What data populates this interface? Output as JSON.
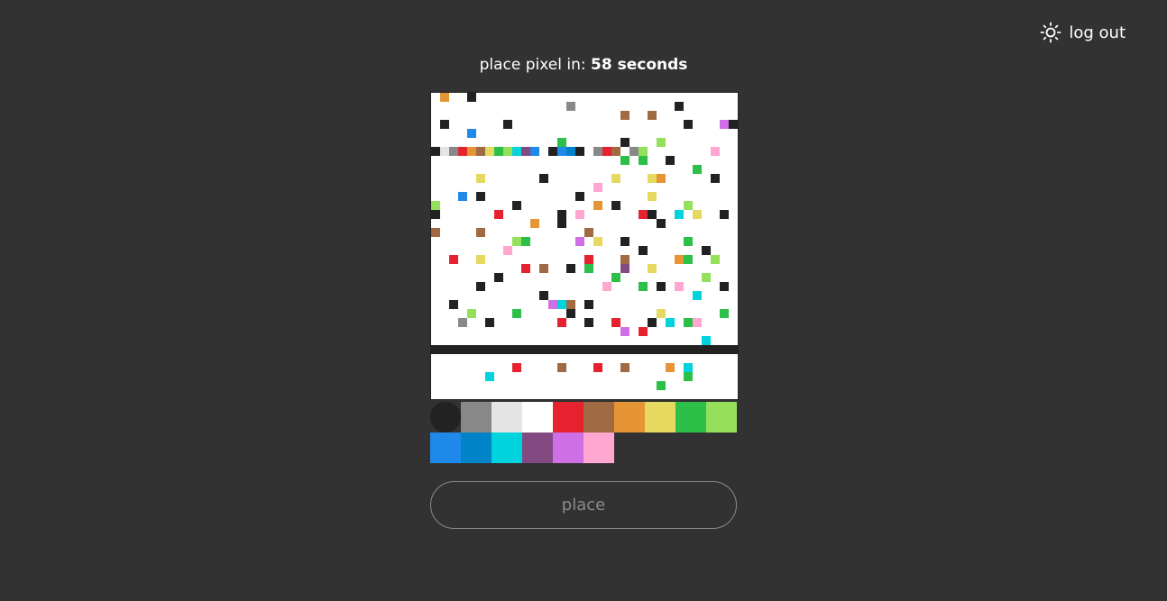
{
  "header": {
    "theme_icon": "sun-icon",
    "logout_label": "log out"
  },
  "timer": {
    "prefix": "place pixel in: ",
    "value": "58 seconds"
  },
  "place_button": {
    "label": "place"
  },
  "palette": {
    "selected": "#222222",
    "colors": [
      "#222222",
      "#888888",
      "#e4e4e4",
      "#ffffff",
      "#e5222e",
      "#a06a42",
      "#e59536",
      "#e5d95f",
      "#2cc049",
      "#94e05b",
      "#1e89e9",
      "#0083c8",
      "#00d3dd",
      "#824a80",
      "#cf6fe5",
      "#ffa7d1"
    ]
  },
  "board": {
    "cells": 34,
    "background": "#ffffff",
    "pixels": [
      [
        1,
        0,
        "#e59536"
      ],
      [
        4,
        0,
        "#222222"
      ],
      [
        15,
        1,
        "#888888"
      ],
      [
        27,
        1,
        "#222222"
      ],
      [
        21,
        2,
        "#a06a42"
      ],
      [
        24,
        2,
        "#a06a42"
      ],
      [
        1,
        3,
        "#222222"
      ],
      [
        8,
        3,
        "#222222"
      ],
      [
        28,
        3,
        "#222222"
      ],
      [
        32,
        3,
        "#cf6fe5"
      ],
      [
        33,
        3,
        "#222222"
      ],
      [
        4,
        4,
        "#1e89e9"
      ],
      [
        14,
        5,
        "#2cc049"
      ],
      [
        21,
        5,
        "#222222"
      ],
      [
        25,
        5,
        "#94e05b"
      ],
      [
        0,
        6,
        "#222222"
      ],
      [
        1,
        6,
        "#e4e4e4"
      ],
      [
        2,
        6,
        "#888888"
      ],
      [
        3,
        6,
        "#e5222e"
      ],
      [
        4,
        6,
        "#e59536"
      ],
      [
        5,
        6,
        "#a06a42"
      ],
      [
        6,
        6,
        "#e5d95f"
      ],
      [
        7,
        6,
        "#2cc049"
      ],
      [
        8,
        6,
        "#94e05b"
      ],
      [
        9,
        6,
        "#00d3dd"
      ],
      [
        10,
        6,
        "#824a80"
      ],
      [
        11,
        6,
        "#1e89e9"
      ],
      [
        13,
        6,
        "#222222"
      ],
      [
        14,
        6,
        "#1e89e9"
      ],
      [
        15,
        6,
        "#0083c8"
      ],
      [
        16,
        6,
        "#222222"
      ],
      [
        18,
        6,
        "#888888"
      ],
      [
        19,
        6,
        "#e5222e"
      ],
      [
        20,
        6,
        "#a06a42"
      ],
      [
        22,
        6,
        "#888888"
      ],
      [
        23,
        6,
        "#94e05b"
      ],
      [
        31,
        6,
        "#ffa7d1"
      ],
      [
        21,
        7,
        "#2cc049"
      ],
      [
        23,
        7,
        "#2cc049"
      ],
      [
        26,
        7,
        "#222222"
      ],
      [
        29,
        8,
        "#2cc049"
      ],
      [
        5,
        9,
        "#e5d95f"
      ],
      [
        12,
        9,
        "#222222"
      ],
      [
        20,
        9,
        "#e5d95f"
      ],
      [
        24,
        9,
        "#e5d95f"
      ],
      [
        25,
        9,
        "#e59536"
      ],
      [
        31,
        9,
        "#222222"
      ],
      [
        18,
        10,
        "#ffa7d1"
      ],
      [
        3,
        11,
        "#1e89e9"
      ],
      [
        5,
        11,
        "#222222"
      ],
      [
        16,
        11,
        "#222222"
      ],
      [
        24,
        11,
        "#e5d95f"
      ],
      [
        0,
        12,
        "#94e05b"
      ],
      [
        9,
        12,
        "#222222"
      ],
      [
        18,
        12,
        "#e59536"
      ],
      [
        20,
        12,
        "#222222"
      ],
      [
        28,
        12,
        "#94e05b"
      ],
      [
        0,
        13,
        "#222222"
      ],
      [
        7,
        13,
        "#e5222e"
      ],
      [
        14,
        13,
        "#222222"
      ],
      [
        16,
        13,
        "#ffa7d1"
      ],
      [
        23,
        13,
        "#e5222e"
      ],
      [
        24,
        13,
        "#222222"
      ],
      [
        27,
        13,
        "#00d3dd"
      ],
      [
        29,
        13,
        "#e5d95f"
      ],
      [
        32,
        13,
        "#222222"
      ],
      [
        11,
        14,
        "#e59536"
      ],
      [
        14,
        14,
        "#222222"
      ],
      [
        25,
        14,
        "#222222"
      ],
      [
        0,
        15,
        "#a06a42"
      ],
      [
        5,
        15,
        "#a06a42"
      ],
      [
        17,
        15,
        "#a06a42"
      ],
      [
        9,
        16,
        "#94e05b"
      ],
      [
        10,
        16,
        "#2cc049"
      ],
      [
        16,
        16,
        "#cf6fe5"
      ],
      [
        18,
        16,
        "#e5d95f"
      ],
      [
        21,
        16,
        "#222222"
      ],
      [
        28,
        16,
        "#2cc049"
      ],
      [
        8,
        17,
        "#ffa7d1"
      ],
      [
        23,
        17,
        "#222222"
      ],
      [
        30,
        17,
        "#222222"
      ],
      [
        2,
        18,
        "#e5222e"
      ],
      [
        5,
        18,
        "#e5d95f"
      ],
      [
        17,
        18,
        "#e5222e"
      ],
      [
        21,
        18,
        "#a06a42"
      ],
      [
        27,
        18,
        "#e59536"
      ],
      [
        28,
        18,
        "#2cc049"
      ],
      [
        31,
        18,
        "#94e05b"
      ],
      [
        10,
        19,
        "#e5222e"
      ],
      [
        12,
        19,
        "#a06a42"
      ],
      [
        15,
        19,
        "#222222"
      ],
      [
        17,
        19,
        "#2cc049"
      ],
      [
        21,
        19,
        "#824a80"
      ],
      [
        24,
        19,
        "#e5d95f"
      ],
      [
        7,
        20,
        "#222222"
      ],
      [
        20,
        20,
        "#2cc049"
      ],
      [
        30,
        20,
        "#94e05b"
      ],
      [
        5,
        21,
        "#222222"
      ],
      [
        19,
        21,
        "#ffa7d1"
      ],
      [
        23,
        21,
        "#2cc049"
      ],
      [
        25,
        21,
        "#222222"
      ],
      [
        27,
        21,
        "#ffa7d1"
      ],
      [
        32,
        21,
        "#222222"
      ],
      [
        12,
        22,
        "#222222"
      ],
      [
        29,
        22,
        "#00d3dd"
      ],
      [
        2,
        23,
        "#222222"
      ],
      [
        13,
        23,
        "#cf6fe5"
      ],
      [
        14,
        23,
        "#00d3dd"
      ],
      [
        15,
        23,
        "#a06a42"
      ],
      [
        17,
        23,
        "#222222"
      ],
      [
        4,
        24,
        "#94e05b"
      ],
      [
        9,
        24,
        "#2cc049"
      ],
      [
        15,
        24,
        "#222222"
      ],
      [
        25,
        24,
        "#e5d95f"
      ],
      [
        32,
        24,
        "#2cc049"
      ],
      [
        3,
        25,
        "#888888"
      ],
      [
        6,
        25,
        "#222222"
      ],
      [
        14,
        25,
        "#e5222e"
      ],
      [
        17,
        25,
        "#222222"
      ],
      [
        20,
        25,
        "#e5222e"
      ],
      [
        24,
        25,
        "#222222"
      ],
      [
        26,
        25,
        "#00d3dd"
      ],
      [
        28,
        25,
        "#2cc049"
      ],
      [
        29,
        25,
        "#ffa7d1"
      ],
      [
        21,
        26,
        "#cf6fe5"
      ],
      [
        23,
        26,
        "#e5222e"
      ],
      [
        30,
        27,
        "#00d3dd"
      ],
      [
        9,
        30,
        "#e5222e"
      ],
      [
        14,
        30,
        "#a06a42"
      ],
      [
        18,
        30,
        "#e5222e"
      ],
      [
        21,
        30,
        "#a06a42"
      ],
      [
        26,
        30,
        "#e59536"
      ],
      [
        28,
        30,
        "#00d3dd"
      ],
      [
        6,
        31,
        "#00d3dd"
      ],
      [
        28,
        31,
        "#2cc049"
      ],
      [
        25,
        32,
        "#2cc049"
      ]
    ],
    "rows": [
      [
        28,
        "#222222"
      ]
    ]
  }
}
